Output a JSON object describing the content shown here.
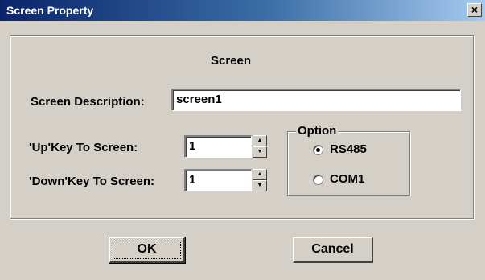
{
  "window": {
    "title": "Screen Property",
    "close_glyph": "×"
  },
  "group": {
    "heading": "Screen"
  },
  "description": {
    "label": "Screen Description:",
    "value": "screen1"
  },
  "up_key": {
    "label": "'Up'Key To Screen:",
    "value": "1"
  },
  "down_key": {
    "label": "'Down'Key To Screen:",
    "value": "1"
  },
  "option": {
    "legend": "Option",
    "items": [
      {
        "label": "RS485",
        "selected": true
      },
      {
        "label": "COM1",
        "selected": false
      }
    ]
  },
  "buttons": {
    "ok": "OK",
    "cancel": "Cancel"
  },
  "spin_glyphs": {
    "up": "▲",
    "down": "▼"
  }
}
